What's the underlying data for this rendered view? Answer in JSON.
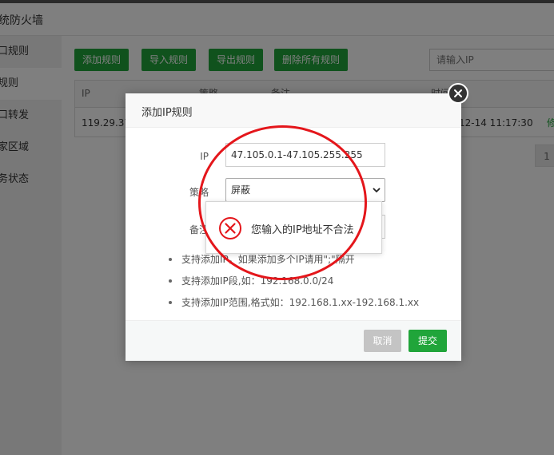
{
  "page": {
    "title": "统防火墙",
    "sidebar": [
      {
        "label": "口规则",
        "active": false
      },
      {
        "label": "规则",
        "active": true
      },
      {
        "label": "口转发",
        "active": false
      },
      {
        "label": "家区域",
        "active": false
      },
      {
        "label": "务状态",
        "active": false
      }
    ],
    "toolbar": {
      "add_rule": "添加规则",
      "import_rule": "导入规则",
      "export_rule": "导出规则",
      "delete_all": "删除所有规则"
    },
    "search": {
      "placeholder": "请输入IP"
    },
    "table": {
      "headers": {
        "ip": "IP",
        "policy": "策略",
        "note": "备注",
        "time": "时间"
      },
      "row": {
        "ip": "119.29.37.",
        "time": "12-14 11:17:30",
        "action": "修"
      }
    },
    "pagination": {
      "current": "1"
    }
  },
  "modal": {
    "title": "添加IP规则",
    "fields": {
      "ip_label": "IP",
      "ip_value": "47.105.0.1-47.105.255.255",
      "policy_label": "策略",
      "policy_value": "屏蔽",
      "note_label": "备注",
      "note_value": ""
    },
    "tips": [
      "支持添加IP，如果添加多个IP请用\";\"隔开",
      "支持添加IP段,如：192.168.0.0/24",
      "支持添加IP范围,格式如：192.168.1.xx-192.168.1.xx"
    ],
    "cancel_label": "取消",
    "submit_label": "提交"
  },
  "toast": {
    "message": "您输入的IP地址不合法"
  },
  "colors": {
    "primary_green": "#20a53a",
    "error_red": "#e4161b",
    "cancel_gray": "#c4c4c4"
  }
}
